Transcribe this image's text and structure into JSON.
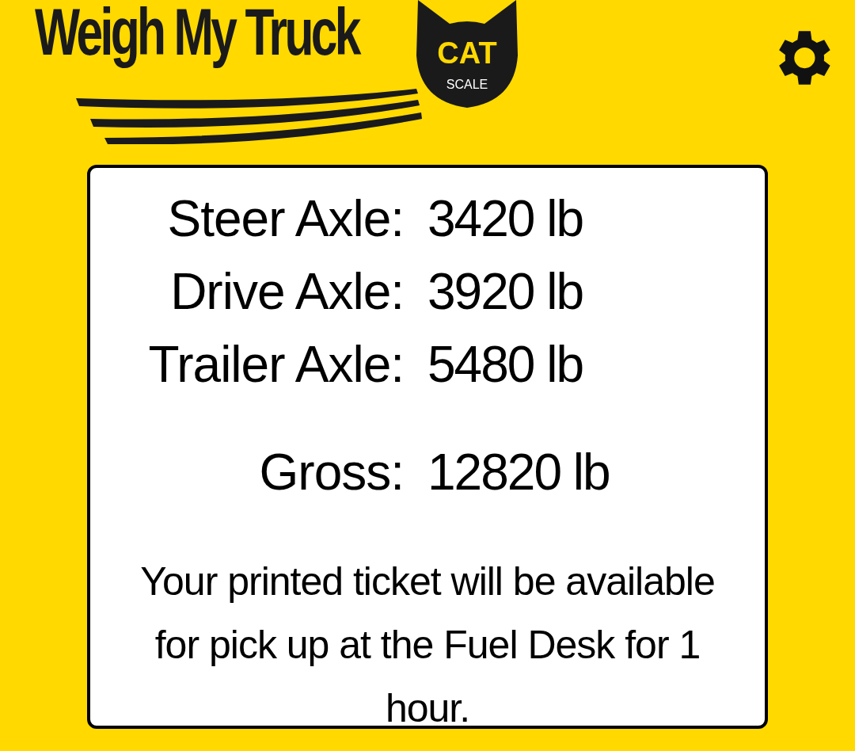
{
  "logo": {
    "title": "Weigh My Truck",
    "badge": "CAT",
    "subtitle": "SCALE"
  },
  "axles": [
    {
      "label": "Steer Axle:",
      "value": "3420 lb"
    },
    {
      "label": "Drive Axle:",
      "value": "3920 lb"
    },
    {
      "label": "Trailer Axle:",
      "value": "5480 lb"
    }
  ],
  "gross": {
    "label": "Gross:",
    "value": "12820 lb"
  },
  "message": "Your printed ticket will be available for pick up at the Fuel Desk for 1 hour."
}
